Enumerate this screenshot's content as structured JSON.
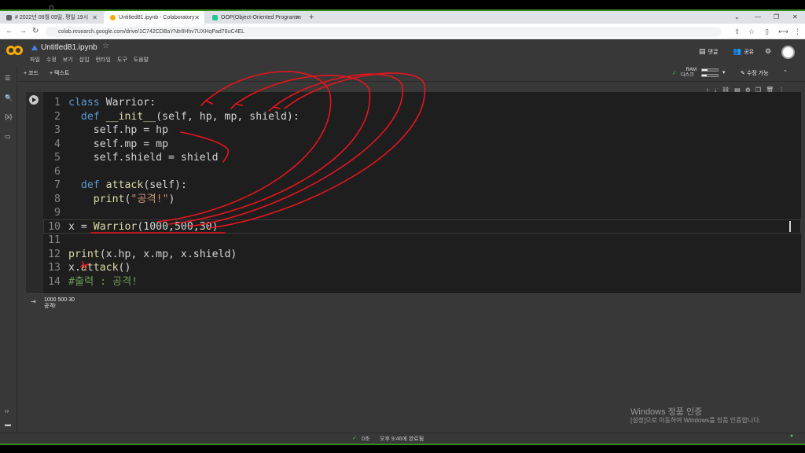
{
  "browser": {
    "tabs": [
      {
        "label": "# 2022년 08월 09일, 평일 19시",
        "favicon_color": "#5f6368"
      },
      {
        "label": "Untitled81.ipynb - Colaboratory",
        "favicon_color": "#f9ab00"
      },
      {
        "label": "OOP(Object-Oriented Programm",
        "favicon_color": "#20c997"
      }
    ],
    "url": "colab.research.google.com/drive/1C742CDBaYNtr8Hhv7UXHqPad76uC4EL"
  },
  "colab": {
    "filename": "Untitled81.ipynb",
    "menus": [
      "파일",
      "수정",
      "보기",
      "삽입",
      "런타임",
      "도구",
      "도움말"
    ],
    "comment_label": "댓글",
    "share_label": "공유",
    "toolbar": {
      "add_code": "+ 코드",
      "add_text": "+ 텍스트",
      "ram_label": "RAM",
      "disk_label": "디스크",
      "edit_mode": "수정 가능"
    }
  },
  "cell": {
    "lines": [
      {
        "n": "1"
      },
      {
        "n": "2"
      },
      {
        "n": "3"
      },
      {
        "n": "4"
      },
      {
        "n": "5"
      },
      {
        "n": "6"
      },
      {
        "n": "7"
      },
      {
        "n": "8"
      },
      {
        "n": "9"
      },
      {
        "n": "10"
      },
      {
        "n": "11"
      },
      {
        "n": "12"
      },
      {
        "n": "13"
      },
      {
        "n": "14"
      }
    ],
    "code": {
      "l1_kw": "class",
      "l1_rest": " Warrior:",
      "l2_kw": "def",
      "l2_fn": "__init__",
      "l2_rest": "(self, hp, mp, shield):",
      "l3": "self.hp = hp",
      "l4": "self.mp = mp",
      "l5": "self.shield = shield",
      "l7_kw": "def",
      "l7_fn": "attack",
      "l7_rest": "(self):",
      "l8_fn": "print",
      "l8_open": "(",
      "l8_str": "\"공격!\"",
      "l8_close": ")",
      "l10_a": "x = ",
      "l10_fn": "Warrior",
      "l10_args": "(1000,500,30)",
      "l12_fn": "print",
      "l12_rest": "(x.hp, x.mp, x.shield)",
      "l13_a": "x.",
      "l13_fn": "attack",
      "l13_rest": "()",
      "l14": "#출력 : 공격!"
    }
  },
  "output": {
    "line1": "1000 500 30",
    "line2": "공격!"
  },
  "watermark": {
    "title": "Windows 정품 인증",
    "sub": "[설정]으로 이동하여 Windows를 정품 인증합니다."
  },
  "status": {
    "check": "0초",
    "completed": "오후 9:46에 완료됨"
  }
}
